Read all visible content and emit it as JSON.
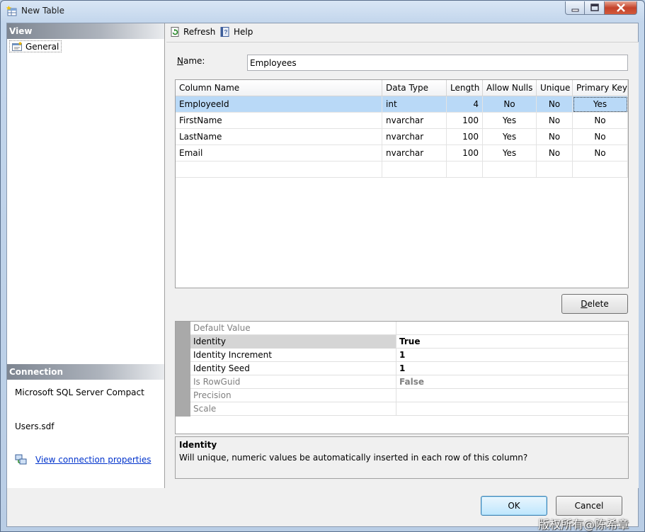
{
  "window": {
    "title": "New Table"
  },
  "left_pane": {
    "view_header": "View",
    "general_item": "General",
    "connection_header": "Connection",
    "server": "Microsoft SQL Server Compact",
    "database": "Users.sdf",
    "connection_link": "View connection properties"
  },
  "toolbar": {
    "refresh_label": "Refresh",
    "help_label": "Help"
  },
  "form": {
    "name_label_prefix": "N",
    "name_label_rest": "ame:",
    "name_value": "Employees"
  },
  "grid": {
    "headers": [
      "Column Name",
      "Data Type",
      "Length",
      "Allow Nulls",
      "Unique",
      "Primary Key"
    ],
    "rows": [
      [
        "EmployeeId",
        "int",
        "4",
        "No",
        "No",
        "Yes"
      ],
      [
        "FirstName",
        "nvarchar",
        "100",
        "Yes",
        "No",
        "No"
      ],
      [
        "LastName",
        "nvarchar",
        "100",
        "Yes",
        "No",
        "No"
      ],
      [
        "Email",
        "nvarchar",
        "100",
        "Yes",
        "No",
        "No"
      ]
    ]
  },
  "delete_label_prefix": "D",
  "delete_label_rest": "elete",
  "properties": [
    {
      "name": "Default Value",
      "value": ""
    },
    {
      "name": "Identity",
      "value": "True"
    },
    {
      "name": "Identity Increment",
      "value": "1"
    },
    {
      "name": "Identity Seed",
      "value": "1"
    },
    {
      "name": "Is RowGuid",
      "value": "False"
    },
    {
      "name": "Precision",
      "value": ""
    },
    {
      "name": "Scale",
      "value": ""
    }
  ],
  "description": {
    "title": "Identity",
    "text": "Will unique, numeric values be automatically inserted in each row of this column?"
  },
  "buttons": {
    "ok": "OK",
    "cancel": "Cancel"
  },
  "watermark": "版权所有@陈希章"
}
